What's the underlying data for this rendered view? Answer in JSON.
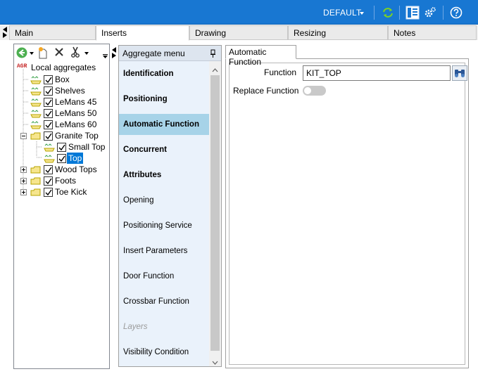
{
  "titlebar": {
    "profile": "DEFAULT",
    "icons": [
      "refresh-icon",
      "layout-icon",
      "settings-icon",
      "help-icon"
    ],
    "accent": "#1877d2"
  },
  "tabs": [
    {
      "label": "Main",
      "active": false
    },
    {
      "label": "Inserts",
      "active": true
    },
    {
      "label": "Drawing",
      "active": false
    },
    {
      "label": "Resizing",
      "active": false
    },
    {
      "label": "Notes",
      "active": false
    }
  ],
  "tree": {
    "root_prefix": "AGR",
    "root_label": "Local aggregates",
    "items": [
      {
        "label": "Box",
        "checked": true
      },
      {
        "label": "Shelves",
        "checked": true
      },
      {
        "label": "LeMans 45",
        "checked": true
      },
      {
        "label": "LeMans 50",
        "checked": true
      },
      {
        "label": "LeMans 60",
        "checked": true
      },
      {
        "label": "Granite Top",
        "checked": true
      },
      {
        "label": "Small Top",
        "checked": true
      },
      {
        "label": "Top",
        "checked": true,
        "selected": true
      },
      {
        "label": "Wood Tops",
        "checked": true
      },
      {
        "label": "Foots",
        "checked": true
      },
      {
        "label": "Toe Kick",
        "checked": true
      }
    ]
  },
  "menu": {
    "title": "Aggregate menu",
    "items": [
      {
        "label": "Identification",
        "style": "bold"
      },
      {
        "label": "Positioning",
        "style": "bold"
      },
      {
        "label": "Automatic Function",
        "style": "bold-active"
      },
      {
        "label": "Concurrent",
        "style": "bold"
      },
      {
        "label": "Attributes",
        "style": "bold"
      },
      {
        "label": "Opening",
        "style": "normal"
      },
      {
        "label": "Positioning Service",
        "style": "normal"
      },
      {
        "label": "Insert Parameters",
        "style": "normal"
      },
      {
        "label": "Door Function",
        "style": "normal"
      },
      {
        "label": "Crossbar Function",
        "style": "normal"
      },
      {
        "label": "Layers",
        "style": "disabled"
      },
      {
        "label": "Visibility Condition",
        "style": "normal"
      }
    ]
  },
  "detail": {
    "tab_label": "Automatic Function",
    "function_label": "Function",
    "function_value": "KIT_TOP",
    "replace_label": "Replace Function",
    "replace_on": false
  }
}
